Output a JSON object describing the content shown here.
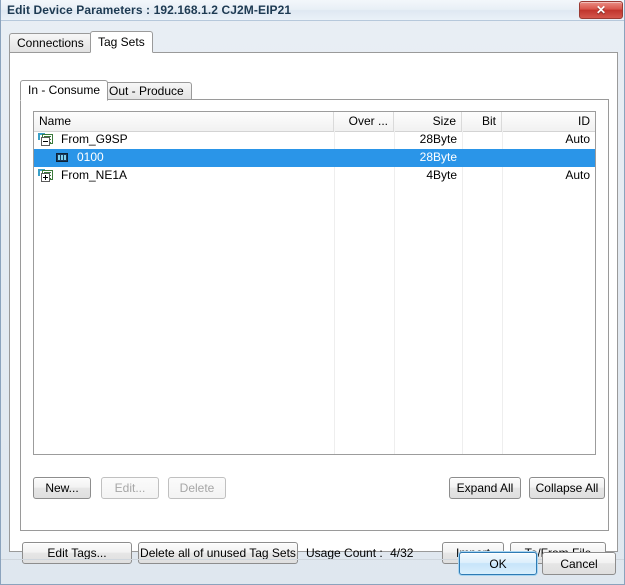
{
  "window": {
    "title": "Edit Device Parameters : 192.168.1.2 CJ2M-EIP21",
    "close_label": "✕"
  },
  "tabs": [
    {
      "label": "Connections",
      "active": false
    },
    {
      "label": "Tag Sets",
      "active": true
    }
  ],
  "inner_tabs": [
    {
      "label": "In - Consume",
      "active": true
    },
    {
      "label": "Out - Produce",
      "active": false
    }
  ],
  "grid": {
    "columns": [
      {
        "label": "Name",
        "align": "left"
      },
      {
        "label": "Over ...",
        "align": "right"
      },
      {
        "label": "Size",
        "align": "right"
      },
      {
        "label": "Bit",
        "align": "right"
      },
      {
        "label": "ID",
        "align": "right"
      }
    ],
    "rows": [
      {
        "name": "From_G9SP",
        "over": "",
        "size": "28Byte",
        "bit": "",
        "id": "Auto",
        "icon": "tagset-collapse-icon",
        "level": 0,
        "selected": false,
        "expander": "minus"
      },
      {
        "name": "0100",
        "over": "",
        "size": "28Byte",
        "bit": "",
        "id": "",
        "icon": "tag-member-icon",
        "level": 1,
        "selected": true,
        "expander": "none"
      },
      {
        "name": "From_NE1A",
        "over": "",
        "size": "4Byte",
        "bit": "",
        "id": "Auto",
        "icon": "tagset-expand-icon",
        "level": 0,
        "selected": false,
        "expander": "plus"
      }
    ]
  },
  "grid_buttons": {
    "new": "New...",
    "edit": "Edit...",
    "delete": "Delete",
    "expand_all": "Expand All",
    "collapse_all": "Collapse All"
  },
  "bottom_bar": {
    "edit_tags": "Edit Tags...",
    "delete_unused": "Delete all of unused Tag Sets",
    "usage_count_label": "Usage Count :",
    "usage_count_value": "4/32",
    "import": "Import",
    "to_from_file": "To/From File"
  },
  "footer": {
    "ok": "OK",
    "cancel": "Cancel"
  },
  "colors": {
    "selection": "#2a95e8",
    "title_text": "#1d3a52",
    "close_red": "#c0342c",
    "default_button_border": "#2e7bb5"
  }
}
